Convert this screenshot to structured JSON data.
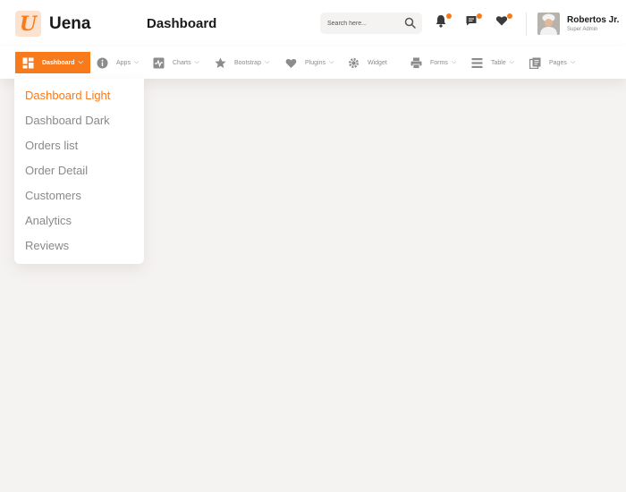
{
  "header": {
    "brand": "Uena",
    "logo_letter": "U",
    "page_title": "Dashboard",
    "search": {
      "placeholder": "Search here...",
      "value": ""
    },
    "icons": [
      "bell-icon",
      "chat-icon",
      "heart-icon"
    ],
    "user": {
      "name": "Robertos Jr.",
      "role": "Super Admin"
    }
  },
  "nav": {
    "items": [
      {
        "label": "Dashboard",
        "icon": "grid-icon",
        "has_chevron": true,
        "active": true
      },
      {
        "label": "Apps",
        "icon": "info-icon",
        "has_chevron": true
      },
      {
        "label": "Charts",
        "icon": "chart-icon",
        "has_chevron": true
      },
      {
        "label": "Bootstrap",
        "icon": "star-icon",
        "has_chevron": true
      },
      {
        "label": "Plugins",
        "icon": "heart-icon",
        "has_chevron": true
      },
      {
        "label": "Widget",
        "icon": "gear-icon",
        "has_chevron": false
      },
      {
        "label": "Forms",
        "icon": "printer-icon",
        "has_chevron": true
      },
      {
        "label": "Table",
        "icon": "table-icon",
        "has_chevron": true
      },
      {
        "label": "Pages",
        "icon": "pages-icon",
        "has_chevron": true
      }
    ],
    "chevron": "⌵"
  },
  "dropdown": {
    "items": [
      "Dashboard Light",
      "Dashboard Dark",
      "Orders list",
      "Order Detail",
      "Customers",
      "Analytics",
      "Reviews"
    ],
    "selected": "Dashboard Light"
  },
  "colors": {
    "accent": "#f97a1b",
    "background": "#f5f3f2",
    "muted_text": "#8a8a8a"
  }
}
